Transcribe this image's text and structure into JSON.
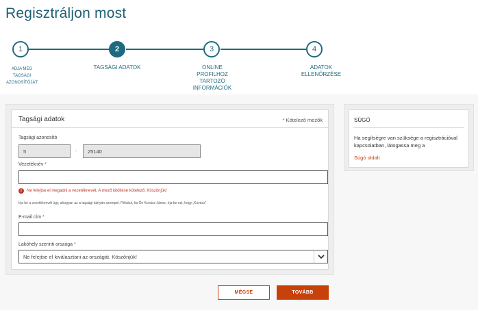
{
  "page_title": "Regisztráljon most",
  "stepper": {
    "steps": [
      {
        "number": "1",
        "label": "ADJA MEG TAGSÁGI AZONOSÍTÓJÁT"
      },
      {
        "number": "2",
        "label": "TAGSÁGI ADATOK"
      },
      {
        "number": "3",
        "label": "ONLINE PROFILHOZ TARTOZÓ INFORMÁCIÓK"
      },
      {
        "number": "4",
        "label": "ADATOK ELLENŐRZÉSE"
      }
    ],
    "active_step": 2
  },
  "form": {
    "title": "Tagsági adatok",
    "required_note_star": "*",
    "required_note": "Kötelező mezők",
    "membership_id": {
      "label": "Tagsági azonosító",
      "part1": "5",
      "separator": "-",
      "part2": "25140"
    },
    "last_name": {
      "label": "Vezetéknév",
      "star": "*",
      "value": "",
      "error": "Ne felejtse el megadni a vezetéknevét. A mező kitöltése kötelező. Köszönjük!",
      "hint": "Írja be a vezetéknevét úgy, ahogyan az a tagsági kártyán szerepel. Például, ha Ön Kovács János, írja be ezt, hogy „Kovács”"
    },
    "email": {
      "label": "E-mail cím",
      "star": "*",
      "value": ""
    },
    "country": {
      "label": "Lakóhely szerinti országa",
      "star": "*",
      "selected": "Ne felejtse el kiválasztani az országát. Köszönjük!"
    }
  },
  "help": {
    "title": "SÚGÓ",
    "text": "Ha segítségre van szüksége a regisztrációval kapcsolatban, látogassa meg a",
    "link": "Súgó oldalt"
  },
  "buttons": {
    "cancel": "MÉGSE",
    "next": "TOVÁBB"
  },
  "colors": {
    "brand_teal": "#1f6a80",
    "accent_orange": "#c8410b",
    "error_red": "#c0392b"
  }
}
